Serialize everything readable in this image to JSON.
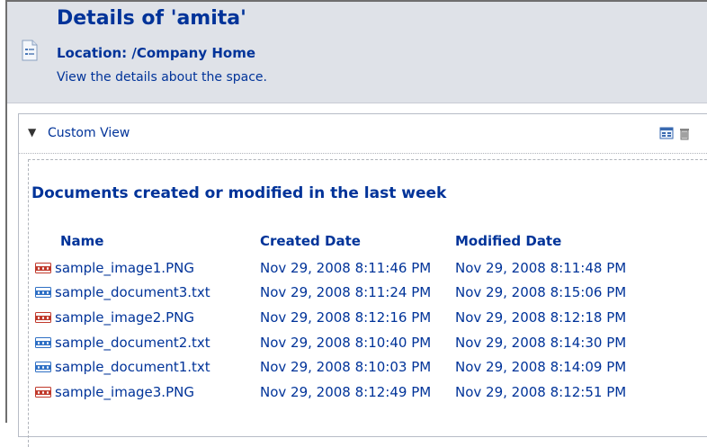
{
  "header": {
    "title": "Details of 'amita'",
    "location": "Location: /Company Home",
    "description": "View the details about the space."
  },
  "panel": {
    "toggle_icon": "triangle-down-icon",
    "view_label": "Custom View",
    "section_title": "Documents created or modified in the last week",
    "columns": [
      "Name",
      "Created Date",
      "Modified Date"
    ],
    "documents": [
      {
        "name": "sample_image1.PNG",
        "type": "png",
        "created": "Nov 29, 2008 8:11:46 PM",
        "modified": "Nov 29, 2008 8:11:48 PM"
      },
      {
        "name": "sample_document3.txt",
        "type": "txt",
        "created": "Nov 29, 2008 8:11:24 PM",
        "modified": "Nov 29, 2008 8:15:06 PM"
      },
      {
        "name": "sample_image2.PNG",
        "type": "png",
        "created": "Nov 29, 2008 8:12:16 PM",
        "modified": "Nov 29, 2008 8:12:18 PM"
      },
      {
        "name": "sample_document2.txt",
        "type": "txt",
        "created": "Nov 29, 2008 8:10:40 PM",
        "modified": "Nov 29, 2008 8:14:30 PM"
      },
      {
        "name": "sample_document1.txt",
        "type": "txt",
        "created": "Nov 29, 2008 8:10:03 PM",
        "modified": "Nov 29, 2008 8:14:09 PM"
      },
      {
        "name": "sample_image3.PNG",
        "type": "png",
        "created": "Nov 29, 2008 8:12:49 PM",
        "modified": "Nov 29, 2008 8:12:51 PM"
      }
    ]
  },
  "icons": {
    "space": "space-details-icon",
    "edit": "edit-view-icon",
    "delete": "delete-view-icon",
    "png": "png-file-icon",
    "txt": "txt-file-icon"
  },
  "colors": {
    "link": "#003399",
    "header_bg": "#dfe2e8",
    "png_icon": "#c0392b",
    "txt_icon": "#2e6fc4"
  }
}
